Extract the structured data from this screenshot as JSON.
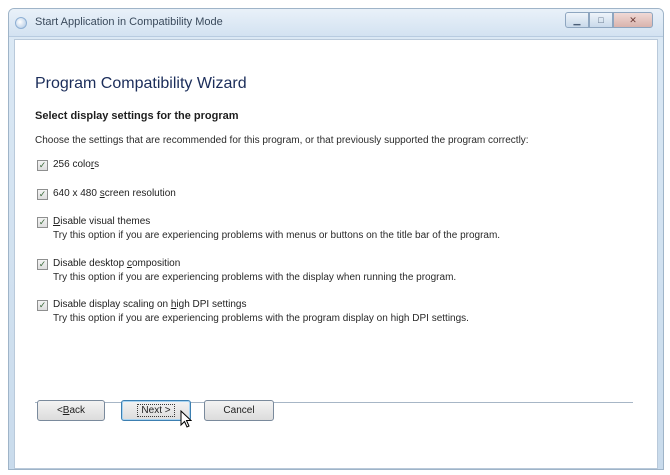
{
  "window": {
    "title": "Start Application in Compatibility Mode"
  },
  "wizard": {
    "title": "Program Compatibility Wizard",
    "section_heading": "Select display settings for the program",
    "intro": "Choose the settings that are recommended for this program, or that previously supported the program correctly:"
  },
  "options": [
    {
      "pre": "256 colo",
      "ul": "r",
      "post": "s",
      "checked": true,
      "description": ""
    },
    {
      "pre": "640 x 480 ",
      "ul": "s",
      "post": "creen resolution",
      "checked": true,
      "description": ""
    },
    {
      "pre": "",
      "ul": "D",
      "post": "isable visual themes",
      "checked": true,
      "description": "Try this option if you are experiencing problems with menus or buttons on the title bar of the program."
    },
    {
      "pre": "Disable desktop ",
      "ul": "c",
      "post": "omposition",
      "checked": true,
      "description": "Try this option if you are experiencing problems with the display when running the program."
    },
    {
      "pre": "Disable display scaling on ",
      "ul": "h",
      "post": "igh DPI settings",
      "checked": true,
      "description": "Try this option if you are experiencing problems with the program display on high DPI settings."
    }
  ],
  "buttons": {
    "back_pre": "< ",
    "back_ul": "B",
    "back_post": "ack",
    "next": "Next >",
    "cancel": "Cancel"
  },
  "icons": {
    "minimize": "minimize-icon",
    "maximize": "maximize-icon",
    "close": "close-icon",
    "checkbox_mark": "✓",
    "cursor": "arrow-cursor-icon"
  }
}
